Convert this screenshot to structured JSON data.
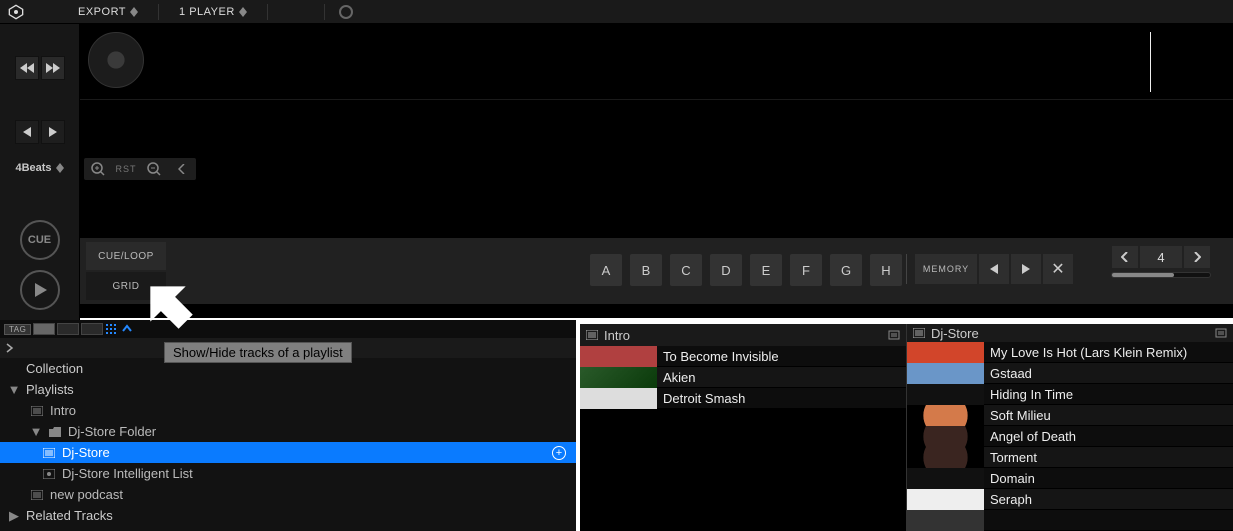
{
  "topbar": {
    "export_label": "EXPORT",
    "players_label": "1 PLAYER"
  },
  "transport": {
    "beats_label": "4Beats",
    "cue_label": "CUE"
  },
  "waveform": {
    "rst_label": "RST"
  },
  "deck_bottom": {
    "cueloop_label": "CUE/LOOP",
    "grid_label": "GRID",
    "hotcues": [
      "A",
      "B",
      "C",
      "D",
      "E",
      "F",
      "G",
      "H"
    ],
    "memory_label": "MEMORY",
    "beatjump_value": "4"
  },
  "view_opts": {
    "tag_label": "TAG"
  },
  "tooltip": "Show/Hide tracks of a playlist",
  "tree": {
    "collection_label": "Collection",
    "playlists_label": "Playlists",
    "intro_label": "Intro",
    "djstore_folder_label": "Dj-Store Folder",
    "djstore_label": "Dj-Store",
    "djstore_intel_label": "Dj-Store Intelligent List",
    "newpodcast_label": "new podcast",
    "related_label": "Related Tracks"
  },
  "pane_a": {
    "title": "Intro",
    "tracks": [
      "To Become Invisible",
      "Akien",
      "Detroit Smash"
    ]
  },
  "pane_b": {
    "title": "Dj-Store",
    "tracks": [
      "My Love Is Hot (Lars Klein Remix)",
      "Gstaad",
      "Hiding In Time",
      "Soft Milieu",
      "Angel of Death",
      "Torment",
      "Domain",
      "Seraph",
      ""
    ]
  }
}
